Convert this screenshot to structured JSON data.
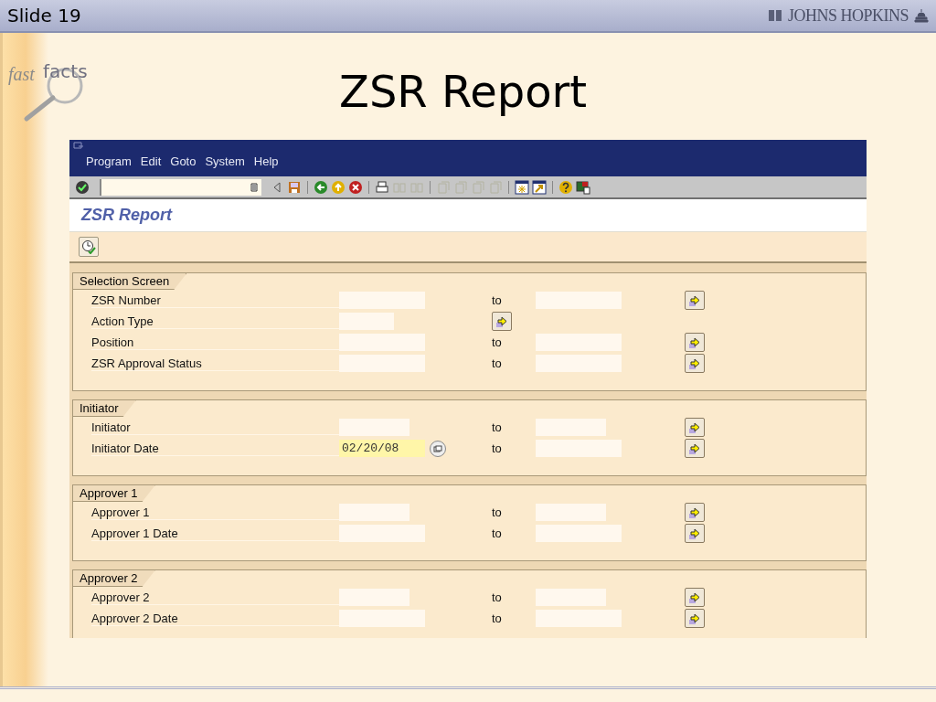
{
  "slide": {
    "number": "Slide 19",
    "brand": "JOHNS HOPKINS",
    "logo_left": "fast",
    "logo_right": "facts",
    "title": "ZSR Report"
  },
  "sap": {
    "menu": [
      "Program",
      "Edit",
      "Goto",
      "System",
      "Help"
    ],
    "toolbar": [
      {
        "kind": "enter",
        "disabled": false
      },
      {
        "kind": "command"
      },
      {
        "kind": "triangle",
        "disabled": false
      },
      {
        "kind": "save",
        "disabled": false
      },
      {
        "kind": "sep"
      },
      {
        "kind": "back",
        "disabled": false
      },
      {
        "kind": "exit",
        "disabled": false
      },
      {
        "kind": "cancel",
        "disabled": false
      },
      {
        "kind": "sep"
      },
      {
        "kind": "print",
        "disabled": false
      },
      {
        "kind": "find",
        "disabled": true
      },
      {
        "kind": "find",
        "disabled": true
      },
      {
        "kind": "sep"
      },
      {
        "kind": "page",
        "disabled": true
      },
      {
        "kind": "page",
        "disabled": true
      },
      {
        "kind": "page",
        "disabled": true
      },
      {
        "kind": "page",
        "disabled": true
      },
      {
        "kind": "sep"
      },
      {
        "kind": "session",
        "disabled": false
      },
      {
        "kind": "shortcut",
        "disabled": false
      },
      {
        "kind": "sep"
      },
      {
        "kind": "help",
        "disabled": false
      },
      {
        "kind": "layout",
        "disabled": false
      }
    ],
    "title": "ZSR Report",
    "groups": [
      {
        "title": "Selection Screen",
        "rows": [
          {
            "kind": "range",
            "label": "ZSR Number",
            "to": "to"
          },
          {
            "kind": "single",
            "label": "Action Type"
          },
          {
            "kind": "range",
            "label": "Position",
            "to": "to"
          },
          {
            "kind": "range",
            "label": "ZSR Approval Status",
            "to": "to"
          }
        ]
      },
      {
        "title": "Initiator",
        "rows": [
          {
            "kind": "range",
            "label": "Initiator",
            "to": "to"
          },
          {
            "kind": "date_range",
            "label": "Initiator Date",
            "value": "02/20/08",
            "to": "to"
          }
        ]
      },
      {
        "title": "Approver 1",
        "rows": [
          {
            "kind": "range",
            "label": "Approver 1",
            "to": "to"
          },
          {
            "kind": "range",
            "label": "Approver 1 Date",
            "to": "to"
          }
        ]
      },
      {
        "title": "Approver 2",
        "rows": [
          {
            "kind": "range",
            "label": "Approver 2",
            "to": "to"
          },
          {
            "kind": "range",
            "label": "Approver 2 Date",
            "to": "to"
          }
        ]
      }
    ]
  }
}
